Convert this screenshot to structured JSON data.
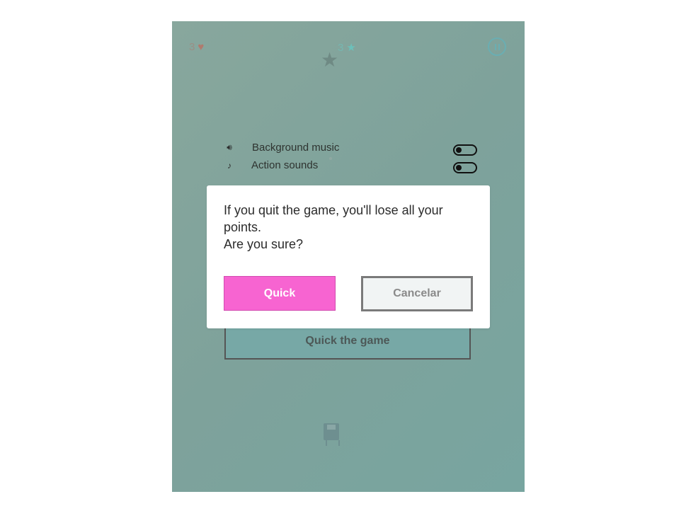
{
  "hud": {
    "lives": "3",
    "stars": "3",
    "lives_icon": "heart-icon",
    "stars_icon": "star-icon",
    "pause_icon": "pause-icon"
  },
  "settings": [
    {
      "label": "Background music",
      "icon": "speaker-icon",
      "toggle": "off"
    },
    {
      "label": "Action sounds",
      "icon": "music-note-icon",
      "toggle": "off"
    }
  ],
  "menu": {
    "quit_label": "Quick the game"
  },
  "dialog": {
    "line1": "If you quit the game, you'll lose all your points.",
    "line2": "Are you sure?",
    "confirm_label": "Quick",
    "cancel_label": "Cancelar"
  },
  "colors": {
    "confirm": "#f764d1",
    "background": "#7ea29b"
  }
}
